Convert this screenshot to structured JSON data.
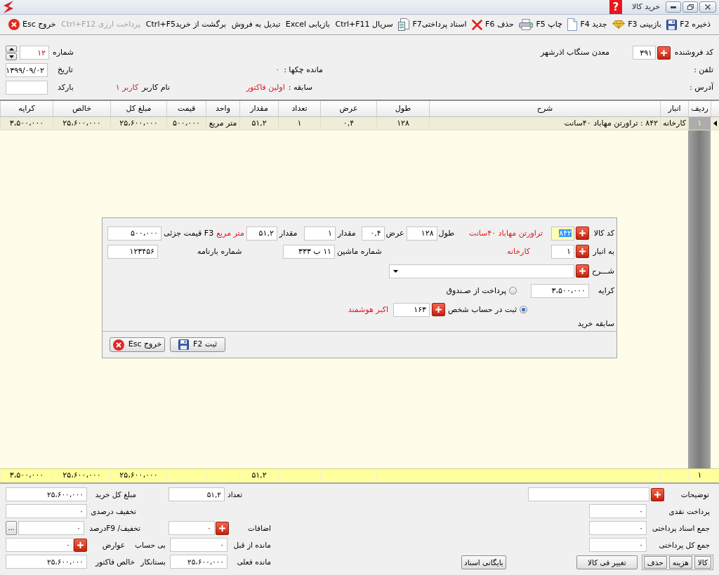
{
  "window": {
    "title": "خرید کالا",
    "help": "?"
  },
  "toolbar": [
    {
      "label": "ذخیره F2",
      "disabled": false
    },
    {
      "label": "بازبینی F3",
      "disabled": false
    },
    {
      "label": "جدید F4",
      "disabled": false
    },
    {
      "label": "چاپ F5",
      "disabled": false
    },
    {
      "label": "حذف F6",
      "disabled": false
    },
    {
      "label": "اسناد پرداختیF7",
      "disabled": false
    },
    {
      "label": "سریال Ctrl+F11",
      "disabled": false
    },
    {
      "label": "بازیابی Excel",
      "disabled": false
    },
    {
      "label": "تبدیل به فروش",
      "disabled": false
    },
    {
      "label": "برگشت از خریدCtrl+F5",
      "disabled": false
    },
    {
      "label": "پرداخت ارزی Ctrl+F12",
      "disabled": true
    },
    {
      "label": "خروج Esc",
      "disabled": false
    }
  ],
  "header": {
    "vendor": {
      "label": "کد فروشنده",
      "code": "۳۹۱",
      "name": "معدن سنگاب اذرشهر"
    },
    "phone": {
      "label": "تلفن :"
    },
    "address": {
      "label": "آدرس :"
    },
    "checks_balance": {
      "label": "مانده چکها :",
      "value": "۰"
    },
    "history": {
      "label": "سابقه :",
      "value": "اولین فاکتور"
    },
    "number": {
      "label": "شماره",
      "value": "۱۲"
    },
    "date": {
      "label": "تاریخ",
      "value": "۱۳۹۹/۰۹/۰۲"
    },
    "user": {
      "label": "نام کاربر",
      "value": "کاربر ۱"
    },
    "barcode": {
      "label": "بارکد"
    }
  },
  "table": {
    "columns": [
      {
        "label": "ردیف",
        "total": "۱"
      },
      {
        "label": "انبار"
      },
      {
        "label": "شرح"
      },
      {
        "label": "طول"
      },
      {
        "label": "عرض"
      },
      {
        "label": "تعداد"
      },
      {
        "label": "مقدار",
        "total": "۵۱,۲"
      },
      {
        "label": "واحد"
      },
      {
        "label": "قیمت"
      },
      {
        "label": "مبلغ کل",
        "total": "۲۵،۶۰۰،۰۰۰"
      },
      {
        "label": "خالص",
        "total": "۲۵،۶۰۰،۰۰۰"
      },
      {
        "label": "کرایه",
        "total": "۳،۵۰۰،۰۰۰"
      }
    ],
    "rows": [
      {
        "selected": true,
        "cells": [
          "۱",
          "کارخانه",
          "۸۴۲ : تراورتن مهاباد ۴۰سانت",
          "۱۲۸",
          "۰,۴",
          "۱",
          "۵۱,۲",
          "متر مربع",
          "۵۰۰،۰۰۰",
          "۲۵،۶۰۰،۰۰۰",
          "۲۵،۶۰۰،۰۰۰",
          "۳،۵۰۰،۰۰۰"
        ]
      }
    ]
  },
  "dialog": {
    "product": {
      "label": "کد کالا",
      "code": "۸۴۲",
      "focused": true,
      "name": "تراورتن مهاباد ۴۰سانت"
    },
    "length": {
      "label": "طول",
      "value": "۱۲۸"
    },
    "width": {
      "label": "عرض",
      "value": "۰,۴"
    },
    "count": {
      "label": "مقدار",
      "value": "۱"
    },
    "quantity": {
      "label": "مقدار",
      "value": "۵۱,۲",
      "unit": "متر مربع"
    },
    "unit_price": {
      "label": "F3 قیمت جزئی",
      "value": "۵۰۰،۰۰۰"
    },
    "warehouse": {
      "label": "به انبار",
      "code": "۱",
      "name": "کارخانه"
    },
    "plate": {
      "label": "شماره ماشین",
      "value": "۱۱ ب ۳۳۳"
    },
    "waybill": {
      "label": "شماره بارنامه",
      "value": "۱۲۳۴۵۶"
    },
    "description": {
      "label": "شـــرح"
    },
    "freight": {
      "label": "کرایه",
      "value": "۳،۵۰۰،۰۰۰"
    },
    "payment_options": [
      {
        "label": "پرداخت از صـندوق",
        "selected": false
      },
      {
        "label": "ثبت در حساب شخص",
        "selected": true
      }
    ],
    "person": {
      "code": "۱۶۳",
      "name": "اکبر هوشمند"
    },
    "history_label": "سابقه خرید",
    "buttons": [
      {
        "label": "ثبت F2"
      },
      {
        "label": "خروج Esc"
      }
    ]
  },
  "summary": {
    "notes": {
      "label": "توضیحات"
    },
    "cash_payment": {
      "label": "پرداخت نقدی",
      "value": "۰"
    },
    "payment_docs_total": {
      "label": "جمع اسناد پرداختی",
      "value": "۰"
    },
    "total_paid": {
      "label": "جمع کل پرداختی",
      "value": "۰"
    },
    "count": {
      "label": "تعداد",
      "value": "۵۱,۲"
    },
    "additions": {
      "label": "اضافات",
      "value": "۰"
    },
    "previous_balance": {
      "label": "مانده از قبل",
      "value": "۰",
      "status": "بی حساب"
    },
    "current_balance": {
      "label": "مانده فعلی",
      "value": "۲۵،۶۰۰،۰۰۰",
      "status": "بستانکار"
    },
    "purchase_total": {
      "label": "مبلغ کل خرید",
      "value": "۲۵،۶۰۰،۰۰۰"
    },
    "percent_discount": {
      "label": "تخفیف درصدی",
      "value": "۰"
    },
    "discount": {
      "label": "تخفیف/ F9درصد",
      "value": "۰",
      "more": "..."
    },
    "duties": {
      "label": "عوارض",
      "value": "۰"
    },
    "invoice_net": {
      "label": "خالص فاکتور",
      "value": "۲۵،۶۰۰،۰۰۰"
    }
  },
  "bottom_buttons": [
    {
      "label": "کالا"
    },
    {
      "label": "هزینه"
    },
    {
      "label": "حذف"
    },
    {
      "label": "تغییر فی کالا"
    },
    {
      "label": "بایگانی اسناد"
    }
  ]
}
